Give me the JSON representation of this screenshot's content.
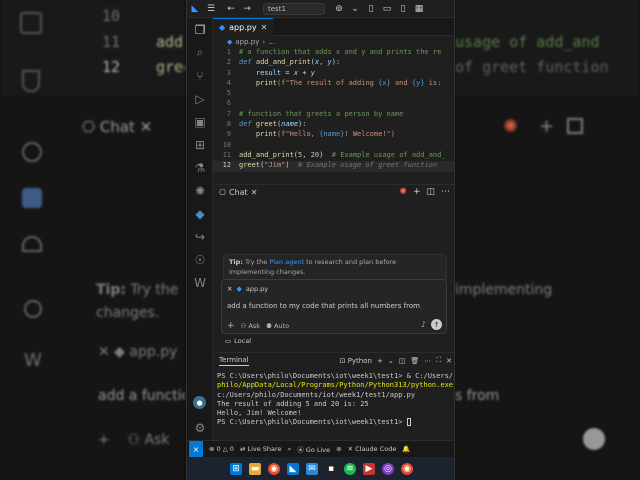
{
  "titlebar": {
    "search_text": "test1"
  },
  "editor": {
    "tab_label": "app.py",
    "breadcrumb": "app.py",
    "breadcrumb_more": "...",
    "line_numbers": [
      "1",
      "2",
      "3",
      "4",
      "5",
      "6",
      "7",
      "8",
      "9",
      "10",
      "11",
      "12"
    ],
    "lines": {
      "l1": "# a function that adds x and y and prints the re",
      "l2_def": "def",
      "l2_name": "add_and_print",
      "l2_open": "(",
      "l2_x": "x",
      "l2_comma": ", ",
      "l2_y": "y",
      "l2_close": "):",
      "l3_var": "result",
      "l3_eq": " = ",
      "l3_x": "x",
      "l3_plus": " + ",
      "l3_y": "y",
      "l4_fn": "print",
      "l4_str1": "(f\"The result of adding ",
      "l4_x": "{x}",
      "l4_str2": " and ",
      "l4_y": "{y}",
      "l4_str3": " is: ",
      "l7": "# function that greets a person by name",
      "l8_def": "def",
      "l8_name": "greet",
      "l8_open": "(",
      "l8_p": "name",
      "l8_close": "):",
      "l9_fn": "print",
      "l9_str1": "(f\"Hello, ",
      "l9_name": "{name}",
      "l9_str2": "! Welcome!\")",
      "l11_fn": "add_and_print",
      "l11_open": "(",
      "l11_a": "5",
      "l11_comma": ", ",
      "l11_b": "20",
      "l11_close": ")  ",
      "l11_comment": "# Example usage of add_and_",
      "l12_fn": "greet",
      "l12_open": "(",
      "l12_str": "\"Jim\"",
      "l12_close": ")  ",
      "l12_ghost": "# Example usage of greet function"
    }
  },
  "chat": {
    "header_label": "Chat",
    "tip_bold": "Tip:",
    "tip_pre": " Try the ",
    "tip_link": "Plan agent",
    "tip_post": " to research and plan before implementing changes.",
    "attachment": "app.py",
    "input_text": "add a function to my code that prints all numbers from",
    "tool_ask": "Ask",
    "tool_auto": "Auto",
    "local_label": "Local"
  },
  "terminal": {
    "tab_label": "Terminal",
    "profile": "Python",
    "lines": [
      "PS C:\\Users\\philo\\Documents\\iot\\week1\\test1> & C:/Users/",
      "philo/AppData/Local/Programs/Python/Python313/python.exe",
      " c:/Users/philo/Documents/iot/week1/test1/app.py",
      "The result of adding 5 and 20 is: 25",
      "Hello, Jim! Welcome!",
      "PS C:\\Users\\philo\\Documents\\iot\\week1\\test1> "
    ]
  },
  "statusbar": {
    "errors": "0",
    "warnings": "0",
    "live_share": "Live Share",
    "go_live": "Go Live",
    "claude": "Claude Code"
  },
  "background": {
    "left_ln10": "10",
    "left_ln11": "11",
    "left_ln12": "12",
    "left_code11": "add",
    "left_code12": "gree",
    "right_code11": "usage of add_and",
    "right_code12": "of greet function",
    "left_chat": "Chat",
    "left_tip_bold": "Tip:",
    "left_tip": "Try the",
    "right_tip": "implementing",
    "left_changes": "changes.",
    "left_file": "app.py",
    "left_addfunc": "add a function",
    "right_from": "s from",
    "left_ask": "Ask"
  },
  "colors": {
    "accent": "#0078d4",
    "editor_bg": "#1f1f1f",
    "statusbar_bg": "#181818"
  }
}
